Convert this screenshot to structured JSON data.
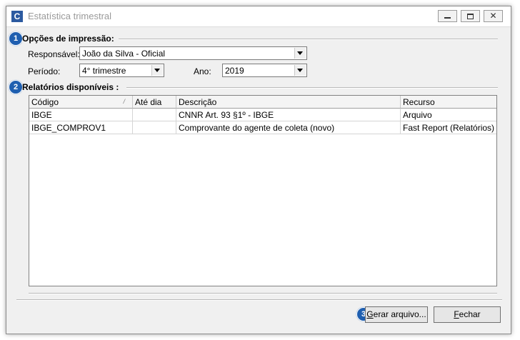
{
  "window": {
    "title": "Estatística trimestral",
    "icon_letter": "C",
    "close_glyph": "✕"
  },
  "badges": {
    "b1": "1",
    "b2": "2",
    "b3": "3"
  },
  "print_options": {
    "title": "Opções de impressão:",
    "responsavel_label": "Responsável:",
    "responsavel_value": "João da Silva - Oficial",
    "periodo_label": "Período:",
    "periodo_value": "4° trimestre",
    "ano_label": "Ano:",
    "ano_value": "2019"
  },
  "reports": {
    "title": "Relatórios disponíveis :",
    "columns": [
      "Código",
      "Até dia",
      "Descrição",
      "Recurso"
    ],
    "sort_glyph": "/",
    "rows": [
      [
        "IBGE",
        "",
        "CNNR Art. 93 §1º - IBGE",
        "Arquivo"
      ],
      [
        "IBGE_COMPROV1",
        "",
        "Comprovante do agente de coleta (novo)",
        "Fast Report (Relatórios)"
      ]
    ]
  },
  "buttons": {
    "gerar_first": "G",
    "gerar_rest": "erar arquivo...",
    "fechar_first": "F",
    "fechar_rest": "echar"
  }
}
